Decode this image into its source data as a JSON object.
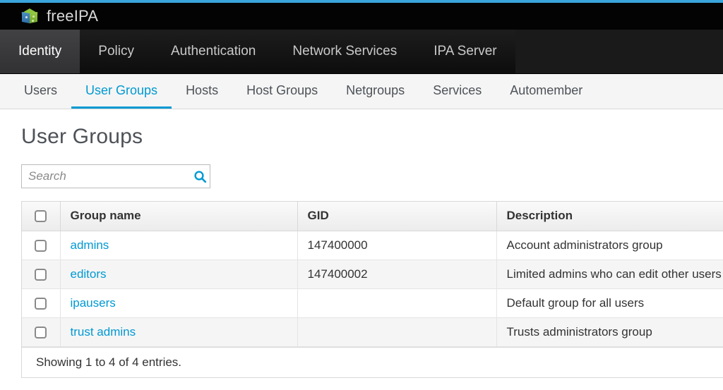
{
  "theme": {
    "accent_blue": "#39a5dc",
    "link_blue": "#0099d3",
    "nav_dark": "#1a1a1a",
    "brand_black": "#030303"
  },
  "brand": {
    "name": "freeIPA",
    "logo_icon": "cube-logo-icon"
  },
  "primary_nav": {
    "items": [
      {
        "label": "Identity",
        "active": true
      },
      {
        "label": "Policy",
        "active": false
      },
      {
        "label": "Authentication",
        "active": false
      },
      {
        "label": "Network Services",
        "active": false
      },
      {
        "label": "IPA Server",
        "active": false
      }
    ]
  },
  "sub_nav": {
    "items": [
      {
        "label": "Users",
        "active": false
      },
      {
        "label": "User Groups",
        "active": true
      },
      {
        "label": "Hosts",
        "active": false
      },
      {
        "label": "Host Groups",
        "active": false
      },
      {
        "label": "Netgroups",
        "active": false
      },
      {
        "label": "Services",
        "active": false
      },
      {
        "label": "Automember",
        "active": false
      }
    ]
  },
  "page": {
    "title": "User Groups"
  },
  "search": {
    "placeholder": "Search",
    "value": "",
    "icon": "search-icon"
  },
  "table": {
    "columns": [
      "Group name",
      "GID",
      "Description"
    ],
    "rows": [
      {
        "selected": false,
        "group_name": "admins",
        "gid": "147400000",
        "description": "Account administrators group"
      },
      {
        "selected": false,
        "group_name": "editors",
        "gid": "147400002",
        "description": "Limited admins who can edit other users"
      },
      {
        "selected": false,
        "group_name": "ipausers",
        "gid": "",
        "description": "Default group for all users"
      },
      {
        "selected": false,
        "group_name": "trust admins",
        "gid": "",
        "description": "Trusts administrators group"
      }
    ],
    "footer": "Showing 1 to 4 of 4 entries."
  }
}
